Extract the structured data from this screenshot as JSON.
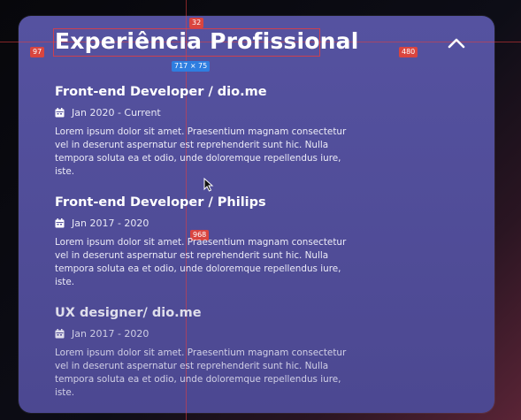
{
  "section": {
    "title": "Experiência Profissional"
  },
  "experiences": [
    {
      "role": "Front-end Developer  / dio.me",
      "date": "Jan 2020 - Current",
      "description": "Lorem ipsum dolor sit amet. Praesentium magnam consectetur vel in deserunt aspernatur est reprehenderit sunt hic. Nulla tempora soluta ea et odio, unde doloremque repellendus iure, iste."
    },
    {
      "role": "Front-end Developer  / Philips",
      "date": "Jan 2017 - 2020",
      "description": "Lorem ipsum dolor sit amet. Praesentium magnam consectetur vel in deserunt aspernatur est reprehenderit sunt hic. Nulla tempora soluta ea et odio, unde doloremque repellendus iure, iste."
    },
    {
      "role": "UX designer/ dio.me",
      "date": "Jan 2017 - 2020",
      "description": "Lorem ipsum dolor sit amet. Praesentium magnam consectetur vel in deserunt aspernatur est reprehenderit sunt hic. Nulla tempora soluta ea et odio, unde doloremque repellendus iure, iste."
    }
  ],
  "devtools": {
    "top_gap": "32",
    "left_gap": "97",
    "right_gap": "480",
    "size_label": "717 × 75",
    "bottom_gap": "968"
  },
  "icons": {
    "toggle": "chevron-up-icon",
    "date": "calendar-icon",
    "pointer": "mouse-cursor-icon"
  },
  "colors": {
    "card": "#5552a0",
    "text": "#ffffff",
    "guide": "#d9453f",
    "size_badge": "#2f7ee0"
  }
}
